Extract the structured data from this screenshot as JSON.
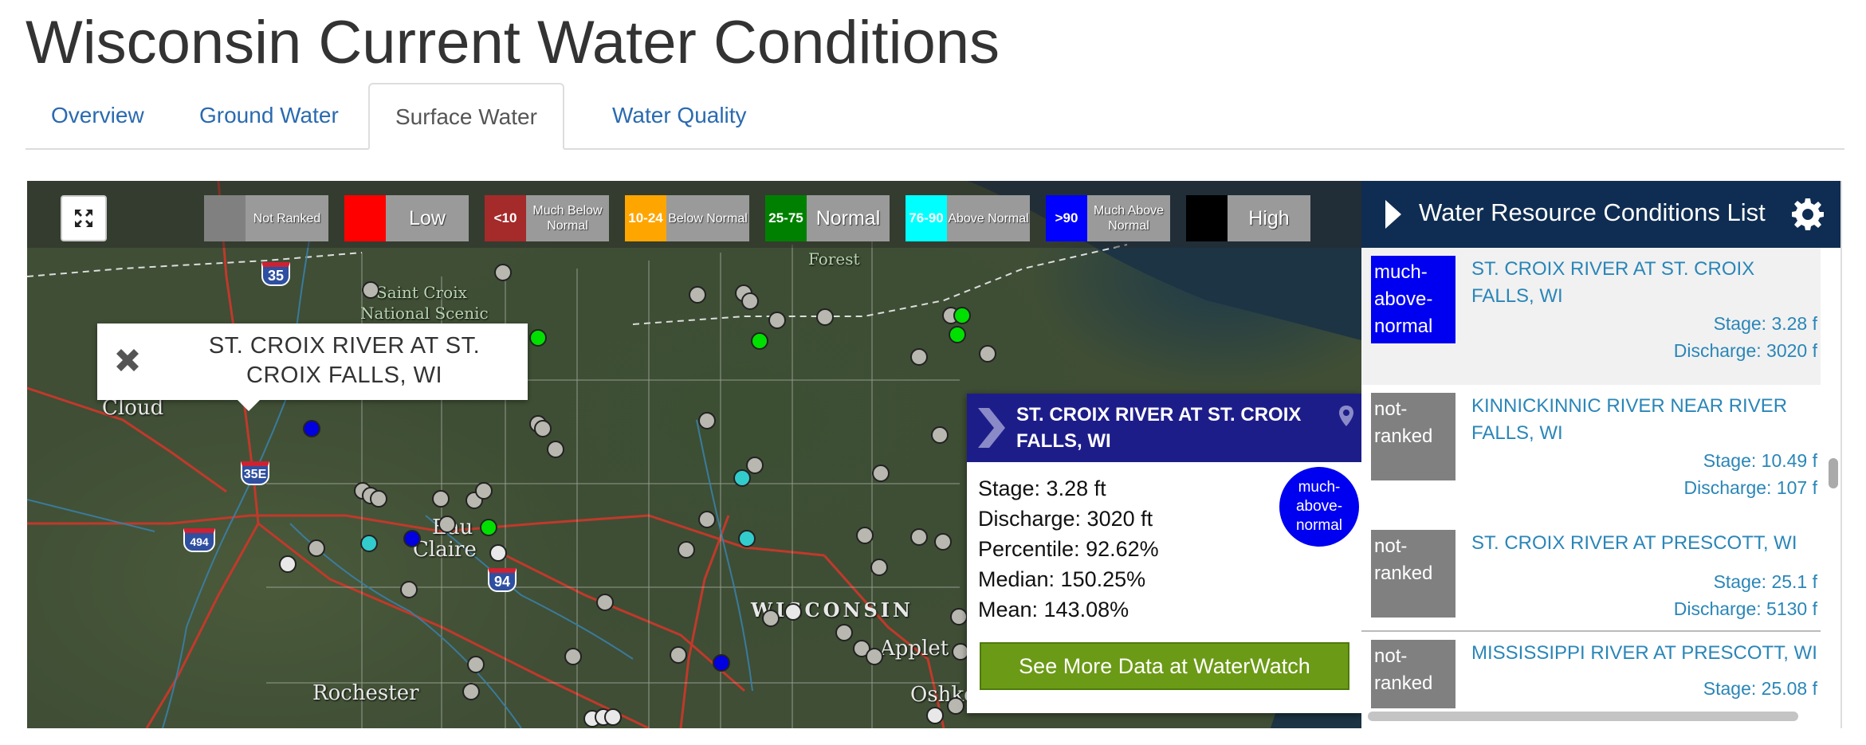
{
  "page_title": "Wisconsin Current Water Conditions",
  "tabs": [
    {
      "label": "Overview"
    },
    {
      "label": "Ground Water"
    },
    {
      "label": "Surface Water"
    },
    {
      "label": "Water Quality"
    }
  ],
  "active_tab": "Surface Water",
  "legend": [
    {
      "swatch": "",
      "label": "Not Ranked",
      "swatch_color": "#808080"
    },
    {
      "swatch": "",
      "label": "Low",
      "swatch_color": "#ff0000"
    },
    {
      "swatch": "<10",
      "label": "Much Below Normal",
      "swatch_color": "#a52a2a"
    },
    {
      "swatch": "10-24",
      "label": "Below Normal",
      "swatch_color": "#ffa500"
    },
    {
      "swatch": "25-75",
      "label": "Normal",
      "swatch_color": "#008000"
    },
    {
      "swatch": "76-90",
      "label": "Above Normal",
      "swatch_color": "#00ffff"
    },
    {
      "swatch": ">90",
      "label": "Much Above Normal",
      "swatch_color": "#0000ff"
    },
    {
      "swatch": "",
      "label": "High",
      "swatch_color": "#000000"
    }
  ],
  "map_labels": {
    "saint_croix": "Saint Croix",
    "national_scenic": "National Scenic",
    "forest": "Forest",
    "cloud": "Cloud",
    "eau": "Eau",
    "claire": "Claire",
    "wisconsin": "WISCONSIN",
    "appleton": "Applet",
    "oshkosh": "Oshko",
    "rochester": "Rochester"
  },
  "highways": {
    "i35": "35",
    "i35e": "35E",
    "i494": "494",
    "i94": "94"
  },
  "tooltip_popup": {
    "title": "ST. CROIX RIVER AT ST. CROIX FALLS, WI"
  },
  "info_popup": {
    "title": "ST. CROIX RIVER AT ST. CROIX FALLS, WI",
    "stage": "Stage: 3.28 ft",
    "discharge": "Discharge: 3020 ft",
    "percentile": "Percentile: 92.62%",
    "median": "Median: 150.25%",
    "mean": "Mean: 143.08%",
    "status": "much-above-normal",
    "status_color": "#0000f0",
    "button_label": "See More Data at WaterWatch"
  },
  "side_panel": {
    "title": "Water Resource Conditions List",
    "items": [
      {
        "badge": "much-above-normal",
        "badge_color": "#0000f0",
        "name": "ST. CROIX RIVER AT ST. CROIX FALLS, WI",
        "stage": "Stage: 3.28 f",
        "discharge": "Discharge: 3020 f"
      },
      {
        "badge": "not-ranked",
        "badge_color": "#808080",
        "name": "KINNICKINNIC RIVER NEAR RIVER FALLS, WI",
        "stage": "Stage: 10.49 f",
        "discharge": "Discharge: 107 f"
      },
      {
        "badge": "not-ranked",
        "badge_color": "#808080",
        "name": "ST. CROIX RIVER AT PRESCOTT, WI",
        "stage": "Stage: 25.1 f",
        "discharge": "Discharge: 5130 f"
      },
      {
        "badge": "not-ranked",
        "badge_color": "#808080",
        "name": "MISSISSIPPI RIVER AT PRESCOTT, WI",
        "stage": "Stage: 25.08 f",
        "discharge": ""
      }
    ]
  },
  "dot_colors": {
    "not_ranked": "#b8b8b0",
    "normal": "#00e000",
    "above_normal": "#33cccc",
    "much_above_normal": "#0000e0"
  }
}
